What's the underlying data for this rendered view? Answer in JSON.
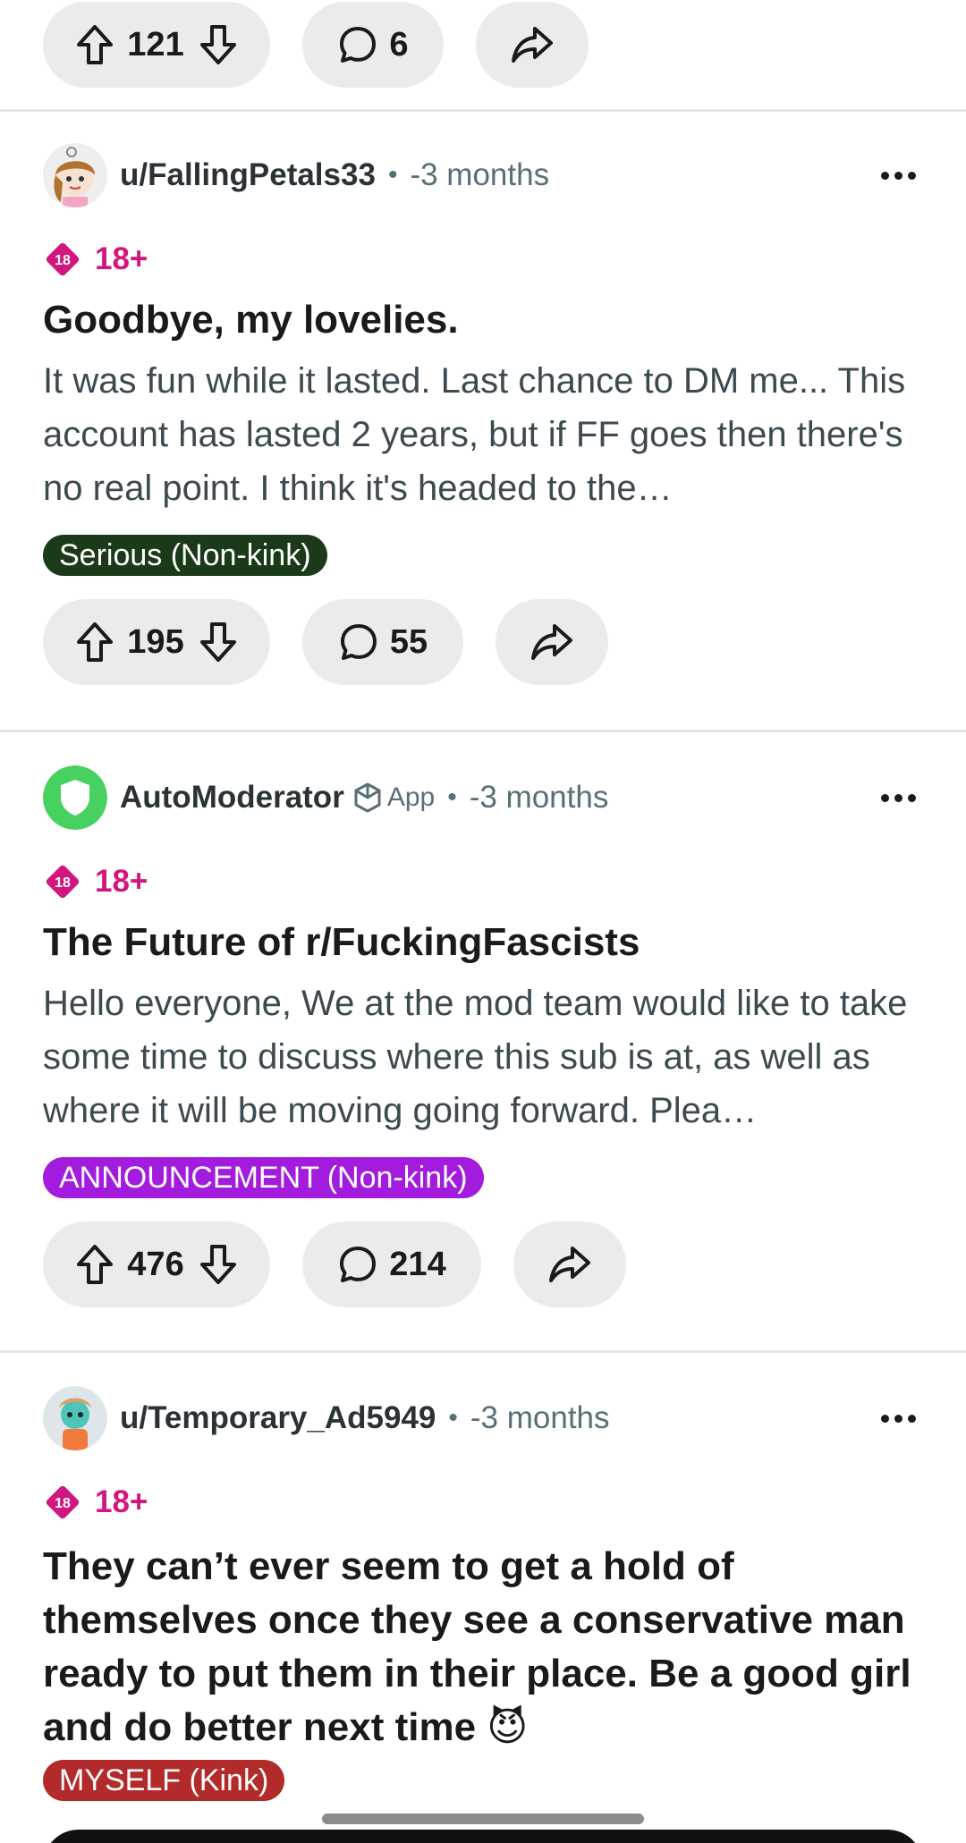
{
  "top_actions": {
    "upvotes": "121",
    "comments": "6"
  },
  "posts": [
    {
      "author": "u/FallingPetals33",
      "time": "-3 months",
      "nsfw_label": "18+",
      "nsfw_badge": "18",
      "title": "Goodbye, my lovelies.",
      "body": "It was fun while it lasted. Last chance to DM me... This account has lasted 2 years, but if FF goes then there's no real point. I think it's headed to the…",
      "flair": "Serious (Non-kink)",
      "flair_color": "#1b3a1a",
      "upvotes": "195",
      "comments": "55"
    },
    {
      "author": "AutoModerator",
      "app_label": "App",
      "time": "-3 months",
      "nsfw_label": "18+",
      "nsfw_badge": "18",
      "title": "The Future of r/FuckingFascists",
      "body": "Hello everyone,   We at the mod team would like to take some time to discuss where this sub is at, as well as where it will be moving going forward. Plea…",
      "flair": "ANNOUNCEMENT (Non-kink)",
      "flair_color": "#a31bdc",
      "upvotes": "476",
      "comments": "214"
    },
    {
      "author": "u/Temporary_Ad5949",
      "time": "-3 months",
      "nsfw_label": "18+",
      "nsfw_badge": "18",
      "title": "They can’t ever seem to get a hold of themselves once they see a conservative man ready to put them in their place. Be a good girl and do better next time 😈",
      "flair": "MYSELF (Kink)",
      "flair_color": "#b22a2a"
    }
  ]
}
